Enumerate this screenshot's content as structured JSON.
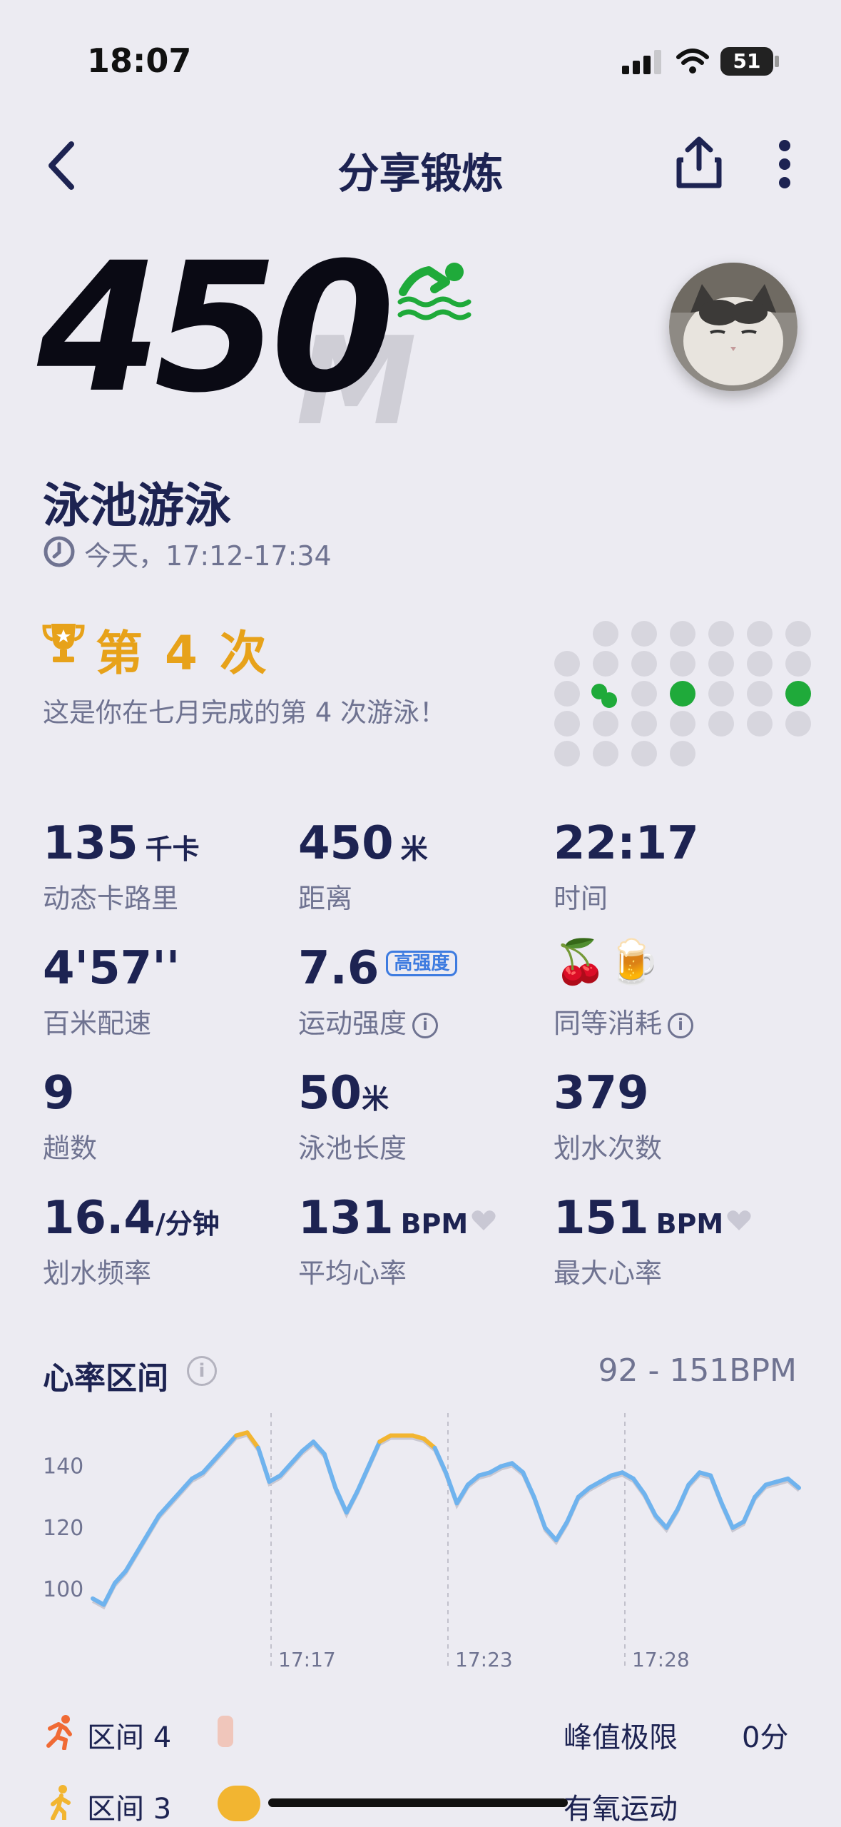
{
  "status_bar": {
    "time": "18:07",
    "battery": "51"
  },
  "header": {
    "title": "分享锻炼"
  },
  "hero": {
    "distance": "450",
    "unit": "M",
    "activity": "泳池游泳",
    "time_range": "今天，17:12-17:34"
  },
  "achievement": {
    "title": "第 4 次",
    "description": "这是你在七月完成的第 4 次游泳！"
  },
  "stats": {
    "calories": {
      "value": "135",
      "unit": "千卡",
      "label": "动态卡路里"
    },
    "distance": {
      "value": "450",
      "unit": "米",
      "label": "距离"
    },
    "duration": {
      "value": "22:17",
      "label": "时间"
    },
    "pace": {
      "value": "4'57''",
      "label": "百米配速"
    },
    "intensity": {
      "value": "7.6",
      "badge": "高强度",
      "label": "运动强度"
    },
    "equivalent": {
      "icons": "🍒🍺",
      "label": "同等消耗"
    },
    "laps": {
      "value": "9",
      "label": "趟数"
    },
    "pool_length": {
      "value": "50",
      "unit": "米",
      "label": "泳池长度"
    },
    "strokes": {
      "value": "379",
      "label": "划水次数"
    },
    "stroke_rate": {
      "value": "16.4",
      "unit": "/分钟",
      "label": "划水频率"
    },
    "avg_hr": {
      "value": "131",
      "unit": "BPM",
      "label": "平均心率"
    },
    "max_hr": {
      "value": "151",
      "unit": "BPM",
      "label": "最大心率"
    }
  },
  "chart_section": {
    "title": "心率区间",
    "range": "92 - 151BPM"
  },
  "chart_data": {
    "type": "line",
    "xlabel": "",
    "ylabel": "",
    "y_ticks": [
      "140",
      "120",
      "100"
    ],
    "x_ticks": [
      "17:17",
      "17:23",
      "17:28"
    ],
    "ylim": [
      90,
      155
    ],
    "series": [
      {
        "values": [
          97,
          95,
          102,
          106,
          112,
          118,
          124,
          128,
          132,
          136,
          138,
          142,
          146,
          150,
          151,
          146,
          135,
          137,
          141,
          145,
          148,
          144,
          133,
          125,
          132,
          140,
          148,
          150,
          150,
          150,
          149,
          146,
          138,
          128,
          134,
          137,
          138,
          140,
          141,
          138,
          130,
          120,
          116,
          122,
          130,
          133,
          135,
          137,
          138,
          136,
          131,
          124,
          120,
          126,
          134,
          138,
          137,
          128,
          120,
          122,
          130,
          134,
          135,
          136,
          133
        ]
      }
    ],
    "highlight_color": "#f2b531",
    "line_color": "#6fb3ee"
  },
  "zones": {
    "zone4": {
      "label": "区间 4",
      "right_label": "峰值极限",
      "right_value": "0分"
    },
    "zone3": {
      "label": "区间 3",
      "right_label": "有氧运动"
    }
  }
}
